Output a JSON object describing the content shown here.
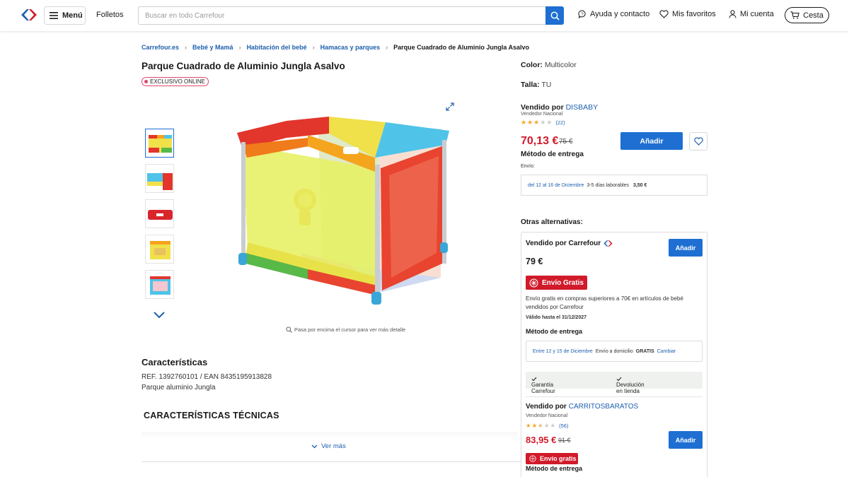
{
  "header": {
    "menu_label": "Menú",
    "folletos_label": "Folletos",
    "search_placeholder": "Buscar en todo Carrefour",
    "help_label": "Ayuda y contacto",
    "favorites_label": "Mis favoritos",
    "account_label": "Mi cuenta",
    "cart_label": "Cesta"
  },
  "breadcrumb": [
    "Carrefour.es",
    "Bebé y Mamá",
    "Habitación del bebé",
    "Hamacas y parques",
    "Parque Cuadrado de Aluminio Jungla Asalvo"
  ],
  "product": {
    "title": "Parque Cuadrado de Aluminio Jungla Asalvo",
    "exclusive_badge": "EXCLUSIVO ONLINE",
    "hover_hint": "Pasa por encima el cursor para ver más detalle",
    "characteristics_title": "Características",
    "ref": "REF. 1392760101 / EAN 8435195913828",
    "description": "Parque aluminio Jungla",
    "tech_title": "CARACTERÍSTICAS TÉCNICAS",
    "ver_mas": "Ver más"
  },
  "buybox": {
    "color_label": "Color:",
    "color_value": "Multicolor",
    "talla_label": "Talla:",
    "talla_value": "TU",
    "vendido_por": "Vendido por",
    "seller": "DISBABY",
    "seller_type": "Vendedor Nacional",
    "rating": 3,
    "rating_count": "(22)",
    "price": "70,13 €",
    "old_price": "75 €",
    "add_label": "Añadir",
    "delivery_method": "Método de entrega",
    "envio_label": "Envío:",
    "delivery_dates": "del 12 al 16 de Diciembre",
    "delivery_days": "3-5 días laborables",
    "delivery_cost": "3,50 €"
  },
  "alternatives": {
    "title": "Otras alternativas:",
    "items": [
      {
        "vendido_por": "Vendido por Carrefour",
        "price": "79 €",
        "add_label": "Añadir",
        "free_shipping": "Envío Gratis",
        "promo_text": "Envío gratis en compras superiores a 70€ en artículos de bebé vendidos por Carrefour",
        "valid_until": "Válido hasta el 31/12/2027",
        "delivery_method": "Método de entrega",
        "delivery_dates": "Entre 12 y 15 de Diciembre",
        "delivery_type": "Envío a domicilio",
        "delivery_cost": "GRATIS",
        "change_label": "Cambiar",
        "guarantee": "Garantía Carrefour",
        "return": "Devolución en tienda"
      },
      {
        "vendido_por": "Vendido por",
        "seller": "CARRITOSBARATOS",
        "seller_type": "Vendedor Nacional",
        "rating": 2.5,
        "rating_count": "(56)",
        "price": "83,95 €",
        "old_price": "91 €",
        "add_label": "Añadir",
        "free_shipping": "Envío gratis",
        "delivery_method": "Método de entrega"
      }
    ]
  },
  "colors": {
    "brand_blue": "#1e6fd1",
    "link_blue": "#1e5fae",
    "price_red": "#d11a2a"
  }
}
